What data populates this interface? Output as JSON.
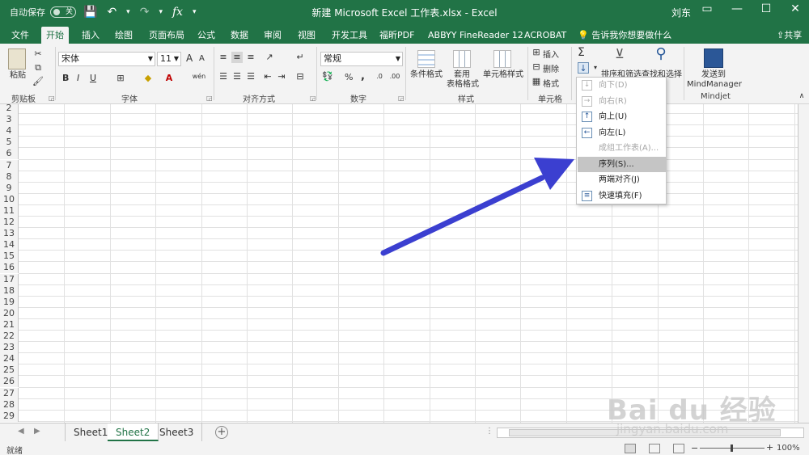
{
  "titlebar": {
    "autosave_label": "自动保存",
    "autosave_state": "关",
    "doc_title": "新建 Microsoft Excel 工作表.xlsx  -  Excel",
    "user": "刘东",
    "controls": [
      "▭",
      "—",
      "☐",
      "✕"
    ]
  },
  "qat": {
    "fx": "fx"
  },
  "tabs": [
    "文件",
    "开始",
    "插入",
    "绘图",
    "页面布局",
    "公式",
    "数据",
    "审阅",
    "视图",
    "开发工具",
    "福昕PDF",
    "ABBYY FineReader 12",
    "ACROBAT"
  ],
  "active_tab": "开始",
  "tell_me": "告诉我你想要做什么",
  "share": "共享",
  "ribbon": {
    "clipboard": {
      "paste": "粘贴",
      "label": "剪贴板"
    },
    "font": {
      "name": "宋体",
      "size": "11",
      "grow": "A",
      "shrink": "A",
      "bold": "B",
      "italic": "I",
      "underline": "U",
      "label": "字体",
      "wen": "wén"
    },
    "alignment": {
      "label": "对齐方式"
    },
    "number": {
      "format": "常规",
      "percent": "%",
      "comma": ",",
      "label": "数字"
    },
    "styles": {
      "conditional": "条件格式",
      "table_line1": "套用",
      "table_line2": "表格格式",
      "cell_styles": "单元格样式",
      "label": "样式"
    },
    "cells": {
      "insert": "插入",
      "delete": "删除",
      "format": "格式",
      "label": "单元格"
    },
    "editing": {
      "sigma": "Σ",
      "sort_filter": "排序和筛选",
      "find_select": "查找和选择"
    },
    "mindjet": {
      "send_line1": "发送到",
      "send_line2": "MindManager",
      "label": "Mindjet"
    }
  },
  "rows": [
    "2",
    "3",
    "4",
    "5",
    "6",
    "7",
    "8",
    "9",
    "10",
    "11",
    "12",
    "13",
    "14",
    "15",
    "16",
    "17",
    "18",
    "19",
    "20",
    "21",
    "22",
    "23",
    "24",
    "25",
    "26",
    "27",
    "28",
    "29"
  ],
  "fill_menu": {
    "items": [
      {
        "label": "向下(D)",
        "icon": "↓",
        "disabled": true
      },
      {
        "label": "向右(R)",
        "icon": "→",
        "disabled": true
      },
      {
        "label": "向上(U)",
        "icon": "↑",
        "disabled": false
      },
      {
        "label": "向左(L)",
        "icon": "←",
        "disabled": false
      },
      {
        "label": "成组工作表(A)...",
        "icon": "",
        "disabled": true
      },
      {
        "label": "序列(S)...",
        "icon": "",
        "disabled": false,
        "hover": true
      },
      {
        "label": "两端对齐(J)",
        "icon": "",
        "disabled": false
      },
      {
        "label": "快速填充(F)",
        "icon": "≡",
        "disabled": false
      }
    ]
  },
  "sheets": [
    "Sheet1",
    "Sheet2",
    "Sheet3"
  ],
  "active_sheet": "Sheet2",
  "status": {
    "text": "就绪",
    "zoom": "100%"
  },
  "annotation_color": "#3b3fd0",
  "accent_color": "#217346",
  "watermark": {
    "big": "Bai du 经验",
    "small": "jingyan.baidu.com"
  }
}
